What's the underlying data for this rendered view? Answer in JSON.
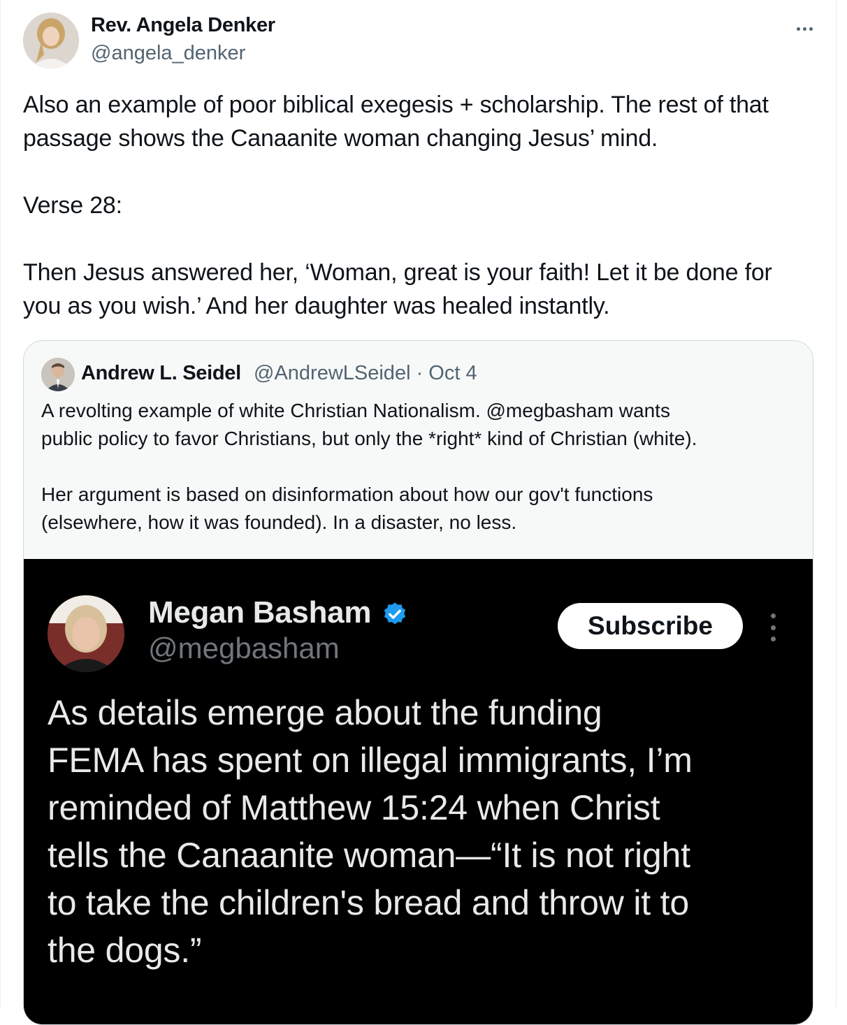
{
  "post": {
    "author_name": "Rev. Angela Denker",
    "author_handle": "@angela_denker",
    "more_label": "More",
    "text_lines": [
      "Also an example of poor biblical exegesis + scholarship. The rest of that",
      "passage shows the Canaanite woman changing Jesus’ mind.",
      "",
      "Verse 28:",
      "",
      "Then Jesus answered her, ‘Woman, great is your faith! Let it be done for",
      "you as you wish.’ And her daughter was healed instantly."
    ]
  },
  "quote": {
    "author_name": "Andrew L. Seidel",
    "meta": "@AndrewLSeidel · Oct 4",
    "text_lines": [
      "A revolting example of white Christian Nationalism. @megbasham wants",
      "public policy to favor Christians, but only the *right* kind of Christian (white).",
      "",
      "Her argument is based on disinformation about how our gov't functions",
      "(elsewhere, how it was founded). In a disaster, no less."
    ],
    "embedded": {
      "author_name": "Megan Basham",
      "author_handle": "@megbasham",
      "subscribe_label": "Subscribe",
      "verified_color": "#1d9bf0",
      "text_lines": [
        "As details emerge about the funding",
        "FEMA has spent on illegal immigrants, I’m",
        "reminded of Matthew 15:24 when Christ",
        "tells the Canaanite woman—“It is not right",
        "to take the children's bread and throw it to",
        "the dogs.”"
      ]
    }
  },
  "icons": {
    "more": "more-horizontal-icon",
    "verified": "verified-badge-icon",
    "embedded_more": "more-vertical-icon"
  }
}
